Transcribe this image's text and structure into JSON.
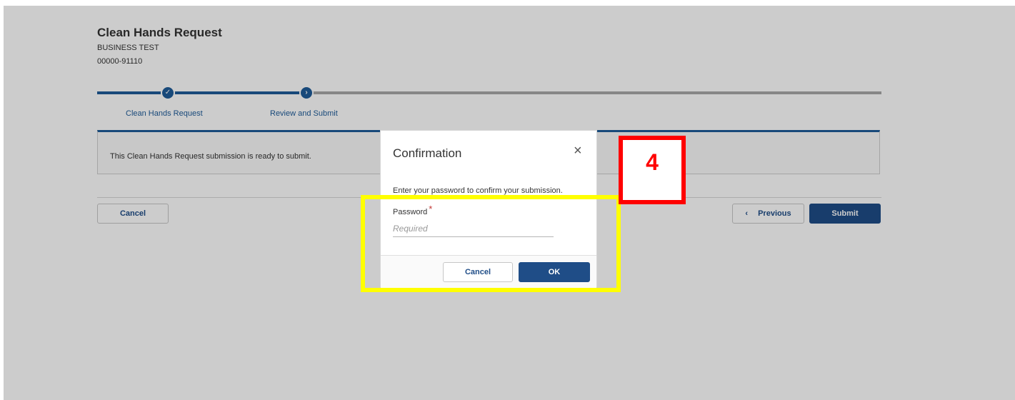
{
  "header": {
    "title": "Clean Hands Request",
    "business_name": "BUSINESS TEST",
    "account_number": "00000-91110"
  },
  "stepper": {
    "steps": [
      {
        "label": "Clean Hands Request",
        "status": "complete"
      },
      {
        "label": "Review and Submit",
        "status": "current"
      }
    ]
  },
  "info": {
    "message": "This Clean Hands Request submission is ready to submit."
  },
  "actions": {
    "cancel_label": "Cancel",
    "previous_label": "Previous",
    "submit_label": "Submit"
  },
  "dialog": {
    "title": "Confirmation",
    "message": "Enter your password to confirm your submission.",
    "password_label": "Password",
    "required_marker": "*",
    "password_placeholder": "Required",
    "password_value": "",
    "cancel_label": "Cancel",
    "ok_label": "OK"
  },
  "annotation": {
    "step_number": "4"
  },
  "colors": {
    "accent": "#1f4d87",
    "stepper_complete": "#1f5c99",
    "highlight_yellow": "#ffff00",
    "highlight_red": "#ff0000"
  }
}
